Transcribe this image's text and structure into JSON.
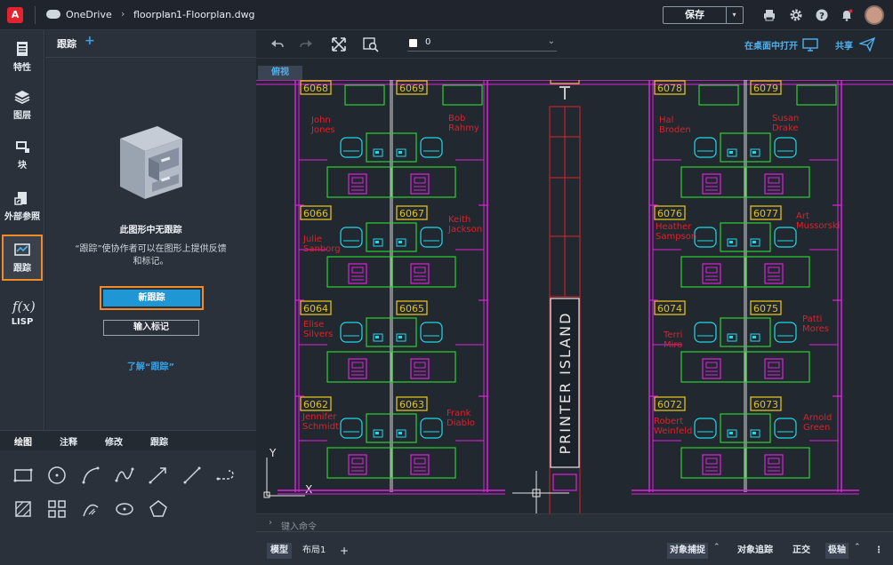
{
  "app": {
    "logo": "A"
  },
  "breadcrumb": {
    "root": "OneDrive",
    "folder": "floorplan",
    "file": "1-Floorplan.dwg",
    "separator": "›"
  },
  "header": {
    "save_label": "保存",
    "save_chevron": "▾"
  },
  "rail": {
    "items": [
      {
        "label": "特性",
        "icon": "properties-icon"
      },
      {
        "label": "图层",
        "icon": "layers-icon"
      },
      {
        "label": "块",
        "icon": "block-icon"
      },
      {
        "label": "外部参照",
        "icon": "xref-icon"
      },
      {
        "label": "跟踪",
        "icon": "trace-icon",
        "active": true
      },
      {
        "label": "LISP",
        "icon": "lisp-icon"
      }
    ]
  },
  "panel": {
    "title": "跟踪",
    "add": "+",
    "empty_title": "此图形中无跟踪",
    "empty_desc": "“跟踪”使协作者可以在图形上提供反馈和标记。",
    "new_button": "新跟踪",
    "import_button": "输入标记",
    "learn_link": "了解“跟踪”"
  },
  "tools": {
    "tabs": [
      "绘图",
      "注释",
      "修改",
      "跟踪"
    ],
    "active_tab": "绘图"
  },
  "viewport": {
    "layer_name": "0",
    "open_desktop": "在桌面中打开",
    "share": "共享",
    "view_tab": "俯视",
    "command_placeholder": "键入命令",
    "command_arrow": "›"
  },
  "drawing": {
    "printer_island": "PRINTER ISLAND",
    "rooms": [
      "6068",
      "6069",
      "6066",
      "6067",
      "6064",
      "6065",
      "6062",
      "6063",
      "6078",
      "6079",
      "6076",
      "6077",
      "6074",
      "6075",
      "6072",
      "6073"
    ],
    "people": [
      {
        "first": "John",
        "last": "Jones"
      },
      {
        "first": "Bob",
        "last": "Rahmy"
      },
      {
        "first": "Julie",
        "last": "Sanborg"
      },
      {
        "first": "Keith",
        "last": "Jackson"
      },
      {
        "first": "Elise",
        "last": "Silvers"
      },
      {
        "first": "Jennifer",
        "last": "Schmidt"
      },
      {
        "first": "Frank",
        "last": "Diablo"
      },
      {
        "first": "Hal",
        "last": "Broden"
      },
      {
        "first": "Susan",
        "last": "Drake"
      },
      {
        "first": "Heather",
        "last": "Sampson"
      },
      {
        "first": "Art",
        "last": "Mussorski"
      },
      {
        "first": "Terri",
        "last": "Miro"
      },
      {
        "first": "Patti",
        "last": "Mores"
      },
      {
        "first": "Robert",
        "last": "Weinfeld"
      },
      {
        "first": "Arnold",
        "last": "Green"
      }
    ],
    "axis_x": "X",
    "axis_y": "Y"
  },
  "statusbar": {
    "model_tab": "模型",
    "layout_tab": "布局1",
    "add_tab": "+",
    "snap": "对象捕捉",
    "tracking": "对象追踪",
    "ortho": "正交",
    "polar": "极轴",
    "more": "⋮"
  },
  "colors": {
    "accent": "#1e97d4",
    "highlight": "#f08b2c",
    "magenta": "#e020e0",
    "green": "#2ed02e",
    "cyan": "#22d8e8",
    "red": "#e0202a",
    "yellow": "#e0c020"
  }
}
